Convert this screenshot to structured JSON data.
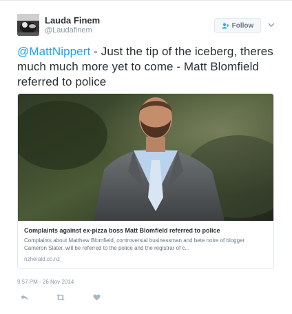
{
  "author": {
    "display_name": "Lauda Finem",
    "handle": "@Laudafinem"
  },
  "follow_button": {
    "label": "Follow"
  },
  "tweet": {
    "mention": "@MattNippert",
    "text": " - Just the tip of the iceberg, theres much much more yet to come - Matt Blomfield referred to police"
  },
  "card": {
    "title": "Complaints against ex-pizza boss Matt Blomfield referred to police",
    "description": "Complaints about Matthew Blomfield, controversial businessman and bete noire of blogger Cameron Slater, will be referred to the police and the registrar of c...",
    "domain": "nzherald.co.nz"
  },
  "timestamp": "9:57 PM - 26 Nov 2014",
  "colors": {
    "link": "#1da1f2",
    "text": "#292f33",
    "muted": "#8899a6",
    "border": "#e1e8ed"
  },
  "icons": {
    "avatar": "avatar-image",
    "follow": "person-plus-icon",
    "menu": "chevron-down-icon",
    "reply": "reply-icon",
    "retweet": "retweet-icon",
    "like": "heart-icon"
  }
}
